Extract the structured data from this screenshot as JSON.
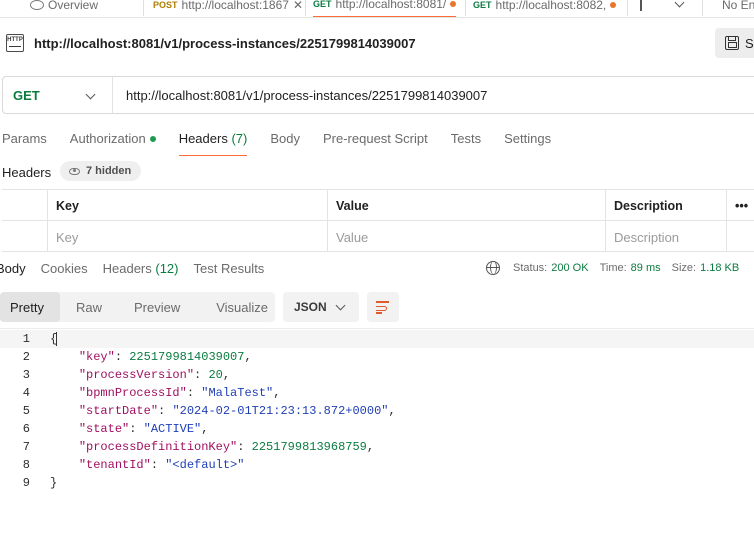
{
  "top_tabs": [
    {
      "method": "",
      "label": "Overview",
      "closable": false
    },
    {
      "method": "POST",
      "label": "http://localhost:1867",
      "closable": true
    },
    {
      "method": "GET",
      "label": "http://localhost:8081/",
      "closable": false,
      "unsaved": true,
      "active": true
    },
    {
      "method": "GET",
      "label": "http://localhost:8082,",
      "closable": false,
      "unsaved": true
    },
    {
      "method": "",
      "label": "No En",
      "closable": false
    }
  ],
  "title_bar": {
    "icon_text": "HTTP",
    "url": "http://localhost:8081/v1/process-instances/2251799814039007",
    "save_label": "S"
  },
  "request": {
    "method": "GET",
    "url": "http://localhost:8081/v1/process-instances/2251799814039007"
  },
  "request_tabs": [
    {
      "label": "Params",
      "count": ""
    },
    {
      "label": "Authorization",
      "count": "",
      "dot": true
    },
    {
      "label": "Headers",
      "count": "(7)",
      "active": true
    },
    {
      "label": "Body",
      "count": ""
    },
    {
      "label": "Pre-request Script",
      "count": ""
    },
    {
      "label": "Tests",
      "count": ""
    },
    {
      "label": "Settings",
      "count": ""
    }
  ],
  "headers_section": {
    "label": "Headers",
    "hidden_label": "7 hidden",
    "columns": [
      "Key",
      "Value",
      "Description"
    ],
    "placeholders": [
      "Key",
      "Value",
      "Description"
    ],
    "more_label": "•••"
  },
  "response_tabs": [
    {
      "label": "Body",
      "count": "",
      "active": true
    },
    {
      "label": "Cookies",
      "count": ""
    },
    {
      "label": "Headers",
      "count": "(12)"
    },
    {
      "label": "Test Results",
      "count": ""
    }
  ],
  "response_stats": {
    "status_label": "Status:",
    "status_value": "200 OK",
    "time_label": "Time:",
    "time_value": "89 ms",
    "size_label": "Size:",
    "size_value": "1.18 KB"
  },
  "view_modes": [
    "Pretty",
    "Raw",
    "Preview",
    "Visualize"
  ],
  "format": "JSON",
  "response_body": [
    {
      "line": 1,
      "indent": "",
      "key": "",
      "value": "",
      "value_type": "",
      "text": "{"
    },
    {
      "line": 2,
      "indent": "    ",
      "key": "\"key\"",
      "value": "2251799814039007",
      "value_type": "num",
      "text": ","
    },
    {
      "line": 3,
      "indent": "    ",
      "key": "\"processVersion\"",
      "value": "20",
      "value_type": "num",
      "text": ","
    },
    {
      "line": 4,
      "indent": "    ",
      "key": "\"bpmnProcessId\"",
      "value": "\"MalaTest\"",
      "value_type": "str",
      "text": ","
    },
    {
      "line": 5,
      "indent": "    ",
      "key": "\"startDate\"",
      "value": "\"2024-02-01T21:23:13.872+0000\"",
      "value_type": "str",
      "text": ","
    },
    {
      "line": 6,
      "indent": "    ",
      "key": "\"state\"",
      "value": "\"ACTIVE\"",
      "value_type": "str",
      "text": ","
    },
    {
      "line": 7,
      "indent": "    ",
      "key": "\"processDefinitionKey\"",
      "value": "2251799813968759",
      "value_type": "num",
      "text": ","
    },
    {
      "line": 8,
      "indent": "    ",
      "key": "\"tenantId\"",
      "value": "\"<default>\"",
      "value_type": "str",
      "text": ""
    },
    {
      "line": 9,
      "indent": "",
      "key": "",
      "value": "",
      "value_type": "",
      "text": "}"
    }
  ]
}
